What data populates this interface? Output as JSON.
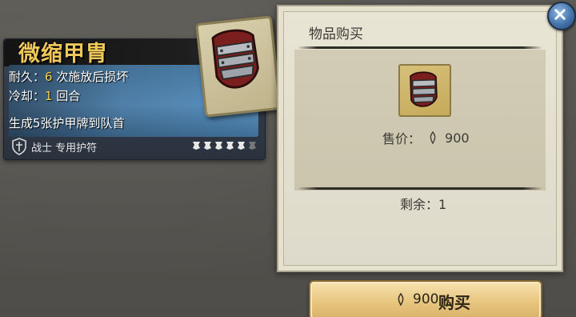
{
  "card": {
    "title": "微缩甲胄",
    "durability_label": "耐久：",
    "durability_value": "6",
    "durability_suffix": " 次施放后损坏",
    "cooldown_label": "冷却：",
    "cooldown_value": "1",
    "cooldown_suffix": " 回合",
    "effect": "生成5张护甲牌到队首",
    "class_label": "战士 专用护符",
    "rarity_stars": 5
  },
  "shop": {
    "title": "物品购买",
    "price_label": "售价：",
    "price_value": "900",
    "remaining_label": "剩余：",
    "remaining_value": "1"
  },
  "buy_button": {
    "price": "900",
    "label": "购买"
  },
  "colors": {
    "highlight": "#f5d44a",
    "title": "#f1c85a",
    "accent_blue": "#3f6ea5"
  },
  "icons": {
    "close": "close-icon",
    "coin": "coin-icon",
    "class": "warrior-shield-icon",
    "star": "star-icon"
  }
}
